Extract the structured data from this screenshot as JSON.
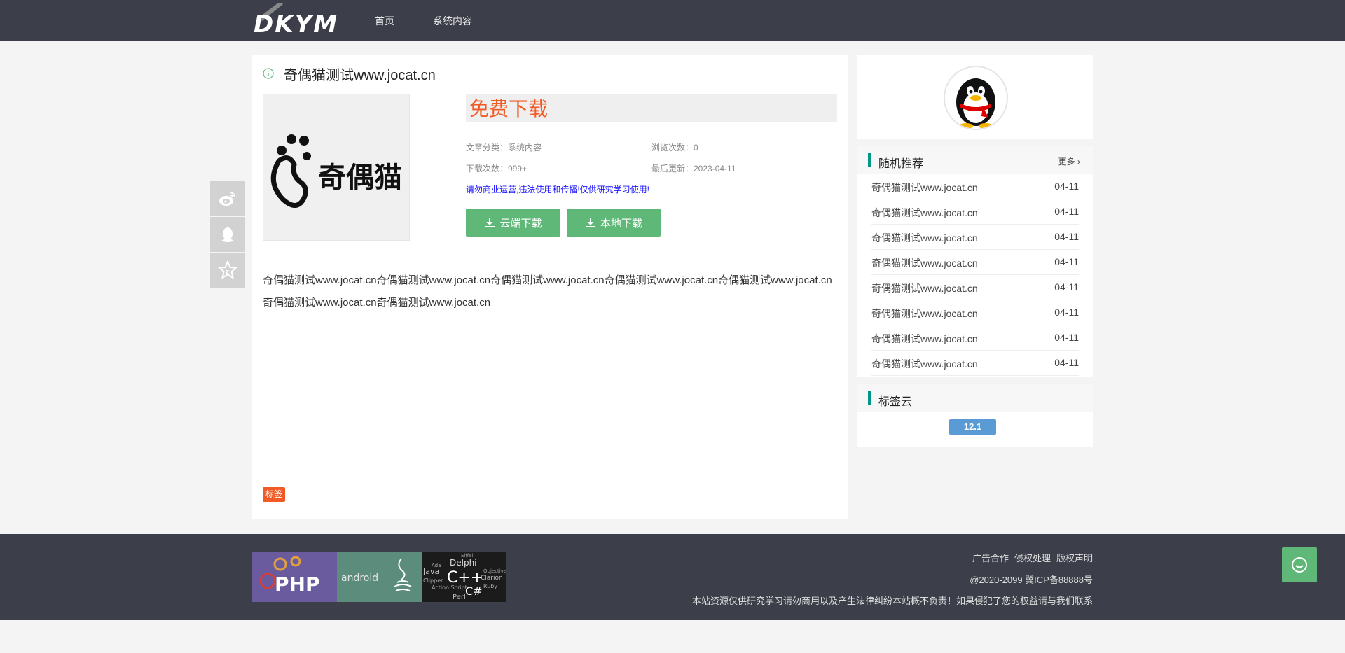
{
  "header": {
    "logo_text": "DKYM",
    "nav": [
      {
        "label": "首页"
      },
      {
        "label": "系统内容"
      }
    ]
  },
  "article": {
    "title": "奇偶猫测试www.jocat.cn",
    "thumb_text": "奇偶猫",
    "download_heading": "免费下载",
    "meta": {
      "category_label": "文章分类：系统内容",
      "views_label": "浏览次数：0",
      "downloads_label": "下载次数：999+",
      "updated_label": "最后更新：2023-04-11"
    },
    "warning": "请勿商业运营,违法使用和传播!仅供研究学习使用!",
    "buttons": {
      "cloud": "云端下载",
      "local": "本地下载"
    },
    "body": "奇偶猫测试www.jocat.cn奇偶猫测试www.jocat.cn奇偶猫测试www.jocat.cn奇偶猫测试www.jocat.cn奇偶猫测试www.jocat.cn奇偶猫测试www.jocat.cn奇偶猫测试www.jocat.cn",
    "tag_label": "标签"
  },
  "sidebar": {
    "random": {
      "title": "随机推荐",
      "more": "更多",
      "items": [
        {
          "title": "奇偶猫测试www.jocat.cn",
          "date": "04-11"
        },
        {
          "title": "奇偶猫测试www.jocat.cn",
          "date": "04-11"
        },
        {
          "title": "奇偶猫测试www.jocat.cn",
          "date": "04-11"
        },
        {
          "title": "奇偶猫测试www.jocat.cn",
          "date": "04-11"
        },
        {
          "title": "奇偶猫测试www.jocat.cn",
          "date": "04-11"
        },
        {
          "title": "奇偶猫测试www.jocat.cn",
          "date": "04-11"
        },
        {
          "title": "奇偶猫测试www.jocat.cn",
          "date": "04-11"
        },
        {
          "title": "奇偶猫测试www.jocat.cn",
          "date": "04-11"
        }
      ]
    },
    "tags": {
      "title": "标签云",
      "items": [
        "12.1"
      ]
    }
  },
  "footer": {
    "links": [
      "广告合作",
      "侵权处理",
      "版权声明"
    ],
    "copyright": "@2020-2099 冀ICP备88888号",
    "note": "本站资源仅供研究学习请勿商用以及产生法律纠纷本站概不负责！如果侵犯了您的权益请与我们联系",
    "banners": {
      "php": "PHP",
      "android": "android",
      "langs": [
        "Delphi",
        "Java",
        "C++",
        "C#",
        "Clarion",
        "Perl",
        "Ruby",
        "Action Script",
        "Clipper",
        "Objective",
        "Ada",
        "Eiffel"
      ]
    }
  },
  "colors": {
    "header_bg": "#3c3f4a",
    "accent_green": "#5fb878",
    "accent_orange": "#f15a24",
    "teal_bar": "#009688",
    "tag_blue": "#5b9bd5"
  }
}
